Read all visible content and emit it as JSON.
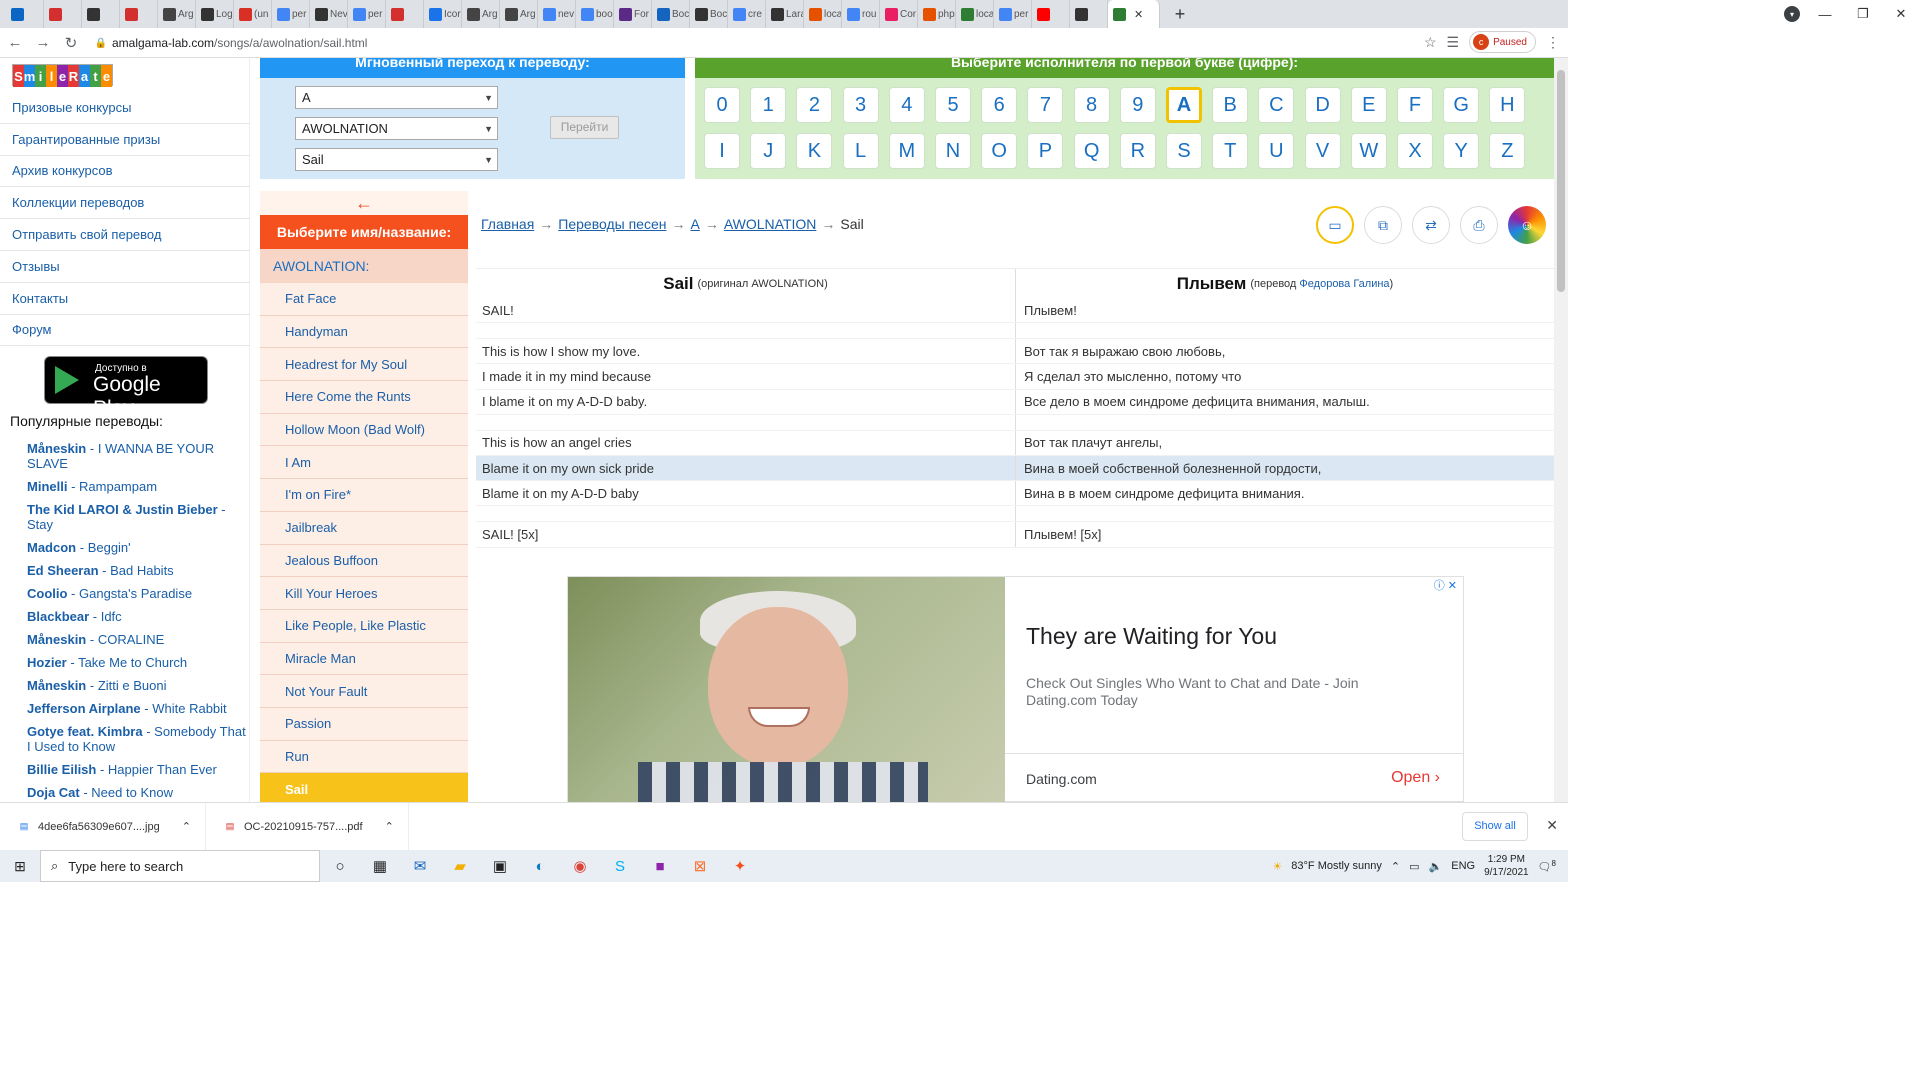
{
  "browser": {
    "tabs": [
      {
        "label": "",
        "icon": "linkedin-icon",
        "color": "#0a66c2"
      },
      {
        "label": "",
        "icon": "pen-icon",
        "color": "#d32f2f"
      },
      {
        "label": "",
        "icon": "clock-icon",
        "color": "#333333"
      },
      {
        "label": "",
        "icon": "pen-icon",
        "color": "#d32f2f"
      },
      {
        "label": "Arg",
        "icon": "person-icon",
        "color": "#444444"
      },
      {
        "label": "Log",
        "icon": "home-icon",
        "color": "#333333"
      },
      {
        "label": "(un",
        "icon": "gmail-icon",
        "color": "#d93025"
      },
      {
        "label": "per",
        "icon": "google-icon",
        "color": "#4285f4"
      },
      {
        "label": "Nev",
        "icon": "clock-icon",
        "color": "#333333"
      },
      {
        "label": "per",
        "icon": "google-icon",
        "color": "#4285f4"
      },
      {
        "label": "",
        "icon": "pen-icon",
        "color": "#d32f2f"
      },
      {
        "label": "Icor",
        "icon": "flag-icon",
        "color": "#1a73e8"
      },
      {
        "label": "Arg",
        "icon": "person-icon",
        "color": "#444444"
      },
      {
        "label": "Arg",
        "icon": "person-icon",
        "color": "#444444"
      },
      {
        "label": "nev",
        "icon": "google-icon",
        "color": "#4285f4"
      },
      {
        "label": "boo",
        "icon": "google-icon",
        "color": "#4285f4"
      },
      {
        "label": "For",
        "icon": "b-icon",
        "color": "#5b2a86"
      },
      {
        "label": "Boc",
        "icon": "mb-icon",
        "color": "#1565c0"
      },
      {
        "label": "Boc",
        "icon": "clock-icon",
        "color": "#333333"
      },
      {
        "label": "cre",
        "icon": "google-icon",
        "color": "#4285f4"
      },
      {
        "label": "Lara",
        "icon": "lm-icon",
        "color": "#333333"
      },
      {
        "label": "loca",
        "icon": "chart-icon",
        "color": "#e65100"
      },
      {
        "label": "rou",
        "icon": "google-icon",
        "color": "#4285f4"
      },
      {
        "label": "Cor",
        "icon": "brain-icon",
        "color": "#e91e63"
      },
      {
        "label": "php",
        "icon": "elephant-icon",
        "color": "#e65100"
      },
      {
        "label": "loca",
        "icon": "v-icon",
        "color": "#2e7d32"
      },
      {
        "label": "per",
        "icon": "google-icon",
        "color": "#4285f4"
      },
      {
        "label": "",
        "icon": "youtube-icon",
        "color": "#ff0000"
      },
      {
        "label": "",
        "icon": "mute-icon",
        "color": "#333333"
      }
    ],
    "active_tab_close": "✕",
    "new_tab": "+",
    "window_controls": {
      "minimize": "—",
      "maximize": "❐",
      "close": "✕"
    },
    "url_domain": "amalgama-lab.com",
    "url_path": "/songs/a/awolnation/sail.html",
    "profile_initial": "c",
    "profile_status": "Paused"
  },
  "sidebar": {
    "logo_letters": [
      "S",
      "m",
      "i",
      "l",
      "e",
      "R",
      "a",
      "t",
      "e"
    ],
    "logo_colors": [
      "#e53935",
      "#1e88e5",
      "#43a047",
      "#fb8c00",
      "#8e24aa",
      "#e53935",
      "#1e88e5",
      "#43a047",
      "#fb8c00"
    ],
    "menu": [
      "Призовые конкурсы",
      "Гарантированные призы",
      "Архив конкурсов",
      "Коллекции переводов",
      "Отправить свой перевод",
      "Отзывы",
      "Контакты",
      "Форум"
    ],
    "gplay_small": "Доступно в",
    "gplay_big": "Google Play",
    "popular_title": "Популярные переводы:",
    "popular": [
      {
        "artist": "Måneskin",
        "song": "I WANNA BE YOUR SLAVE"
      },
      {
        "artist": "Minelli",
        "song": "Rampampam"
      },
      {
        "artist": "The Kid LAROI & Justin Bieber",
        "song": "Stay"
      },
      {
        "artist": "Madcon",
        "song": "Beggin'"
      },
      {
        "artist": "Ed Sheeran",
        "song": "Bad Habits"
      },
      {
        "artist": "Coolio",
        "song": "Gangsta's Paradise"
      },
      {
        "artist": "Blackbear",
        "song": "Idfc"
      },
      {
        "artist": "Måneskin",
        "song": "CORALINE"
      },
      {
        "artist": "Hozier",
        "song": "Take Me to Church"
      },
      {
        "artist": "Måneskin",
        "song": "Zitti e Buoni"
      },
      {
        "artist": "Jefferson Airplane",
        "song": "White Rabbit"
      },
      {
        "artist": "Gotye feat. Kimbra",
        "song": "Somebody That I Used to Know"
      },
      {
        "artist": "Billie Eilish",
        "song": "Happier Than Ever"
      },
      {
        "artist": "Doja Cat",
        "song": "Need to Know"
      }
    ]
  },
  "jump": {
    "title": "Мгновенный переход к переводу:",
    "select_letter": "A",
    "select_artist": "AWOLNATION",
    "select_song": "Sail",
    "go_label": "Перейти"
  },
  "letters": {
    "title": "Выберите исполнителя по первой букве (цифре):",
    "row1": [
      "0",
      "1",
      "2",
      "3",
      "4",
      "5",
      "6",
      "7",
      "8",
      "9",
      "A",
      "B",
      "C",
      "D",
      "E",
      "F",
      "G",
      "H"
    ],
    "row2": [
      "I",
      "J",
      "K",
      "L",
      "M",
      "N",
      "O",
      "P",
      "Q",
      "R",
      "S",
      "T",
      "U",
      "V",
      "W",
      "X",
      "Y",
      "Z"
    ],
    "active": "A"
  },
  "songs": {
    "back_arrow": "←",
    "choose_title": "Выберите имя/название:",
    "artist_label": "AWOLNATION:",
    "list": [
      "Fat Face",
      "Handyman",
      "Headrest for My Soul",
      "Here Come the Runts",
      "Hollow Moon (Bad Wolf)",
      "I Am",
      "I'm on Fire*",
      "Jailbreak",
      "Jealous Buffoon",
      "Kill Your Heroes",
      "Like People, Like Plastic",
      "Miracle Man",
      "Not Your Fault",
      "Passion",
      "Run",
      "Sail"
    ],
    "active": "Sail"
  },
  "breadcrumb": {
    "home": "Главная",
    "translations": "Переводы песен",
    "letter": "A",
    "artist": "AWOLNATION",
    "current": "Sail",
    "separator": "→"
  },
  "lyrics": {
    "orig_title": "Sail",
    "orig_sub_prefix": "(оригинал",
    "orig_sub_artist": "AWOLNATION)",
    "trans_title": "Плывем",
    "trans_sub_prefix": "(перевод",
    "trans_sub_author": "Федорова Галина",
    "trans_sub_suffix": ")",
    "rows": [
      {
        "orig": "SAIL!",
        "trans": "Плывем!"
      },
      {
        "blank": true
      },
      {
        "orig": "This is how I show my love.",
        "trans": "Вот так я выражаю свою любовь,"
      },
      {
        "orig": "I made it in my mind because",
        "trans": "Я сделал это мысленно, потому что"
      },
      {
        "orig": "I blame it on my A-D-D baby.",
        "trans": "Все дело в моем синдроме дефицита внимания, малыш."
      },
      {
        "blank": true
      },
      {
        "orig": "This is how an angel cries",
        "trans": "Вот так плачут ангелы,"
      },
      {
        "orig": "Blame it on my own sick pride",
        "trans": "Вина в моей собственной болезненной гордости,",
        "highlight": true
      },
      {
        "orig": "Blame it on my A-D-D baby",
        "trans": "Вина в в моем синдроме дефицита внимания."
      },
      {
        "blank": true
      },
      {
        "orig": "SAIL! [5x]",
        "trans": "Плывем! [5x]"
      }
    ]
  },
  "ad": {
    "title": "They are Waiting for You",
    "description": "Check Out Singles Who Want to Chat and Date - Join Dating.com Today",
    "source": "Dating.com",
    "open_label": "Open",
    "choices": "ⓘ ✕"
  },
  "downloads": {
    "items": [
      "4dee6fa56309e607....jpg",
      "OC-20210915-757....pdf"
    ],
    "show_all": "Show all"
  },
  "taskbar": {
    "search_placeholder": "Type here to search",
    "weather": "83°F  Mostly sunny",
    "lang": "ENG",
    "time": "1:29 PM",
    "date": "9/17/2021",
    "notif_count": "8"
  }
}
